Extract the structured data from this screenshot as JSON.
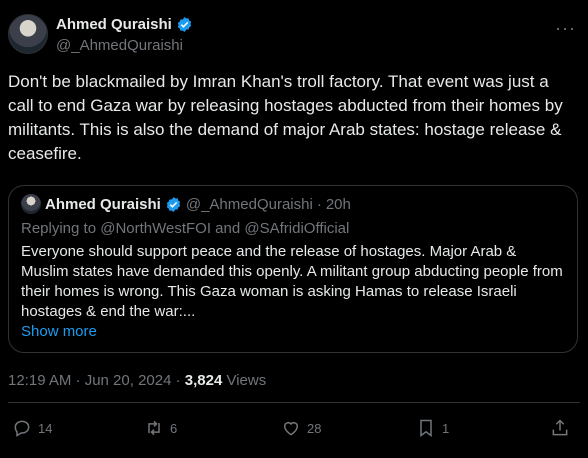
{
  "author": {
    "name": "Ahmed Quraishi",
    "handle": "@_AhmedQuraishi"
  },
  "tweet": {
    "text": "Don't be blackmailed by Imran Khan's troll factory. That event was just a call to end Gaza war by releasing hostages abducted from their homes by militants. This is also the demand of major Arab states: hostage release & ceasefire."
  },
  "quote": {
    "name": "Ahmed Quraishi",
    "handle": "@_AhmedQuraishi",
    "separator": "·",
    "age": "20h",
    "replying_to": "Replying to @NorthWestFOI and @SAfridiOfficial",
    "text": "Everyone should support peace and the release of hostages. Major Arab & Muslim states have demanded this openly. A militant group abducting people from their homes is wrong. This Gaza woman is asking Hamas to release Israeli hostages & end the war:...",
    "show_more": "Show more"
  },
  "meta": {
    "time_date": "12:19 AM · Jun 20, 2024 · ",
    "views_count": "3,824",
    "views_label": " Views"
  },
  "actions": {
    "replies": "14",
    "reposts": "6",
    "likes": "28",
    "bookmarks": "1"
  },
  "colors": {
    "background": "#000000",
    "text": "#e7e9ea",
    "muted": "#71767b",
    "accent": "#1d9bf0",
    "border": "#2f3336"
  }
}
